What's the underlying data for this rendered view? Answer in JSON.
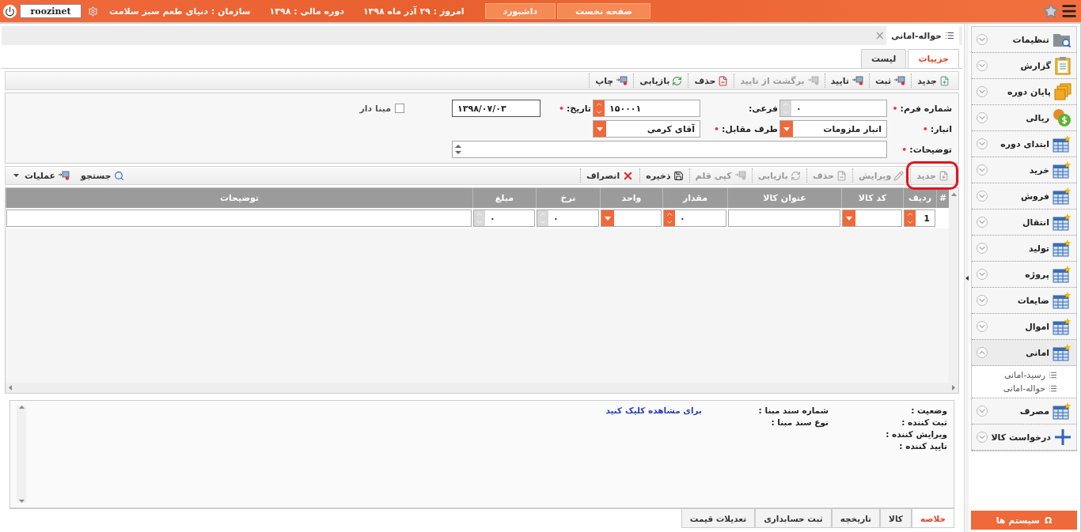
{
  "topbar": {
    "buttons": [
      {
        "label": "صفحه نخست"
      },
      {
        "label": "داشبورد"
      }
    ],
    "today": "امروز :  ۲۹ آذر ماه ۱۳۹۸",
    "fiscal_year": "دوره مالی :  ۱۳۹۸",
    "organization": "سازمان :  دنیای طعم سبز سلامت",
    "user": "roozinet"
  },
  "document_tab": {
    "title": "حواله-امانی",
    "close": "×"
  },
  "tabs": [
    {
      "label": "جزییات",
      "selected": true
    },
    {
      "label": "لیست",
      "selected": false
    }
  ],
  "toolbar": [
    {
      "label": "جدید",
      "kind": "new",
      "disabled": false
    },
    {
      "label": "ثبت",
      "kind": "submit",
      "disabled": false
    },
    {
      "label": "تایید",
      "kind": "submit",
      "disabled": false
    },
    {
      "label": "برگشت از تایید",
      "kind": "submit",
      "disabled": true
    },
    {
      "label": "حذف",
      "kind": "delete",
      "disabled": false
    },
    {
      "label": "بازیابی",
      "kind": "refresh",
      "disabled": false
    },
    {
      "label": "چاپ",
      "kind": "submit",
      "disabled": false
    }
  ],
  "form": {
    "required_mark": "•",
    "rows": [
      [
        {
          "label": "شماره فرم:",
          "required": true,
          "kind": "spinner",
          "value": "۰",
          "disabled": true
        },
        {
          "label": "فرعی:",
          "required": false,
          "kind": "spinner",
          "value": "۱۵۰۰۰۱",
          "disabled": false
        },
        {
          "label": "تاریخ:",
          "required": true,
          "kind": "text",
          "value": "۱۳۹۸/۰۷/۰۳",
          "disabled": false
        },
        {
          "label": "مبنا دار",
          "kind": "checkbox",
          "checked": false
        }
      ],
      [
        {
          "label": "انبار:",
          "required": true,
          "kind": "dropdown",
          "value": "انبار ملزومات",
          "disabled": false
        },
        {
          "label": "طرف مقابل:",
          "required": true,
          "kind": "dropdown",
          "value": "آقای  کرمی",
          "disabled": false
        }
      ],
      [
        {
          "label": "توضیحات:",
          "required": true,
          "kind": "textarea",
          "disabled": false
        }
      ]
    ]
  },
  "grid_toolbar": {
    "items": [
      {
        "label": "جدید",
        "kind": "new",
        "disabled": true,
        "highlighted": true
      },
      {
        "label": "ویرایش",
        "kind": "edit",
        "disabled": true,
        "highlighted": false
      },
      {
        "label": "حذف",
        "kind": "delete",
        "disabled": true,
        "highlighted": false
      },
      {
        "label": "بازیابی",
        "kind": "refresh",
        "disabled": true,
        "highlighted": false
      },
      {
        "label": "کپی قلم",
        "kind": "submit",
        "disabled": true,
        "highlighted": false
      },
      {
        "label": "ذخیره",
        "kind": "save",
        "disabled": false,
        "highlighted": false
      },
      {
        "label": "انصراف",
        "kind": "cancel",
        "disabled": false,
        "highlighted": false
      }
    ],
    "tools": [
      {
        "label": "جستجو",
        "kind": "search"
      },
      {
        "label": "عملیات",
        "kind": "submit"
      }
    ]
  },
  "table": {
    "columns": [
      "#",
      "ردیف",
      "کد کالا",
      "عنوان کالا",
      "مقدار",
      "واحد",
      "نرخ",
      "مبلغ",
      "توضیحات"
    ],
    "rows": [
      [
        {
          "kind": "marker"
        },
        {
          "kind": "spinner",
          "value": "1",
          "disabled": false
        },
        {
          "kind": "dropdown",
          "disabled": false
        },
        {
          "kind": "text"
        },
        {
          "kind": "spinner",
          "value": "۰",
          "disabled": false
        },
        {
          "kind": "dropdown",
          "disabled": false
        },
        {
          "kind": "spinner",
          "value": "۰",
          "disabled": true
        },
        {
          "kind": "spinner",
          "value": "۰",
          "disabled": true
        },
        {
          "kind": "text"
        }
      ]
    ]
  },
  "summary": {
    "labels": [
      "وضعیت :",
      "ثبت کننده :",
      "ویرایش کننده :",
      "تایید کننده :"
    ],
    "source_labels": [
      "شماره سند مبنا :",
      "نوع سند مبنا :"
    ],
    "link": "برای مشاهده کلیک کنید"
  },
  "bottom_tabs": [
    {
      "label": "خلاصه",
      "selected": true
    },
    {
      "label": "کالا",
      "selected": false
    },
    {
      "label": "تاریخچه",
      "selected": false
    },
    {
      "label": "ثبت حسابداری",
      "selected": false
    },
    {
      "label": "تعدیلات قیمت",
      "selected": false
    }
  ],
  "sidebar": {
    "items": [
      {
        "label": "تنظیمات",
        "kind": "folder",
        "expanded": false
      },
      {
        "label": "گزارش",
        "kind": "clipboard",
        "expanded": false
      },
      {
        "label": "پایان دوره",
        "kind": "stack",
        "expanded": false
      },
      {
        "label": "ریالی",
        "kind": "coins",
        "expanded": false
      },
      {
        "label": "ابتدای دوره",
        "kind": "table",
        "expanded": false
      },
      {
        "label": "خرید",
        "kind": "table",
        "expanded": false
      },
      {
        "label": "فروش",
        "kind": "table",
        "expanded": false
      },
      {
        "label": "انتقال",
        "kind": "table",
        "expanded": false
      },
      {
        "label": "تولید",
        "kind": "table",
        "expanded": false
      },
      {
        "label": "پروژه",
        "kind": "table",
        "expanded": false
      },
      {
        "label": "ضایعات",
        "kind": "table",
        "expanded": false
      },
      {
        "label": "اموال",
        "kind": "table",
        "expanded": false
      },
      {
        "label": "امانی",
        "kind": "table",
        "expanded": true,
        "children": [
          {
            "label": "رسید-امانی"
          },
          {
            "label": "حواله-امانی"
          }
        ]
      },
      {
        "label": "مصرف",
        "kind": "table",
        "expanded": false
      },
      {
        "label": "درخواست کالا",
        "kind": "plus",
        "expanded": false
      }
    ],
    "footer": {
      "icon": "Ω",
      "label": "سیستم ها"
    }
  }
}
